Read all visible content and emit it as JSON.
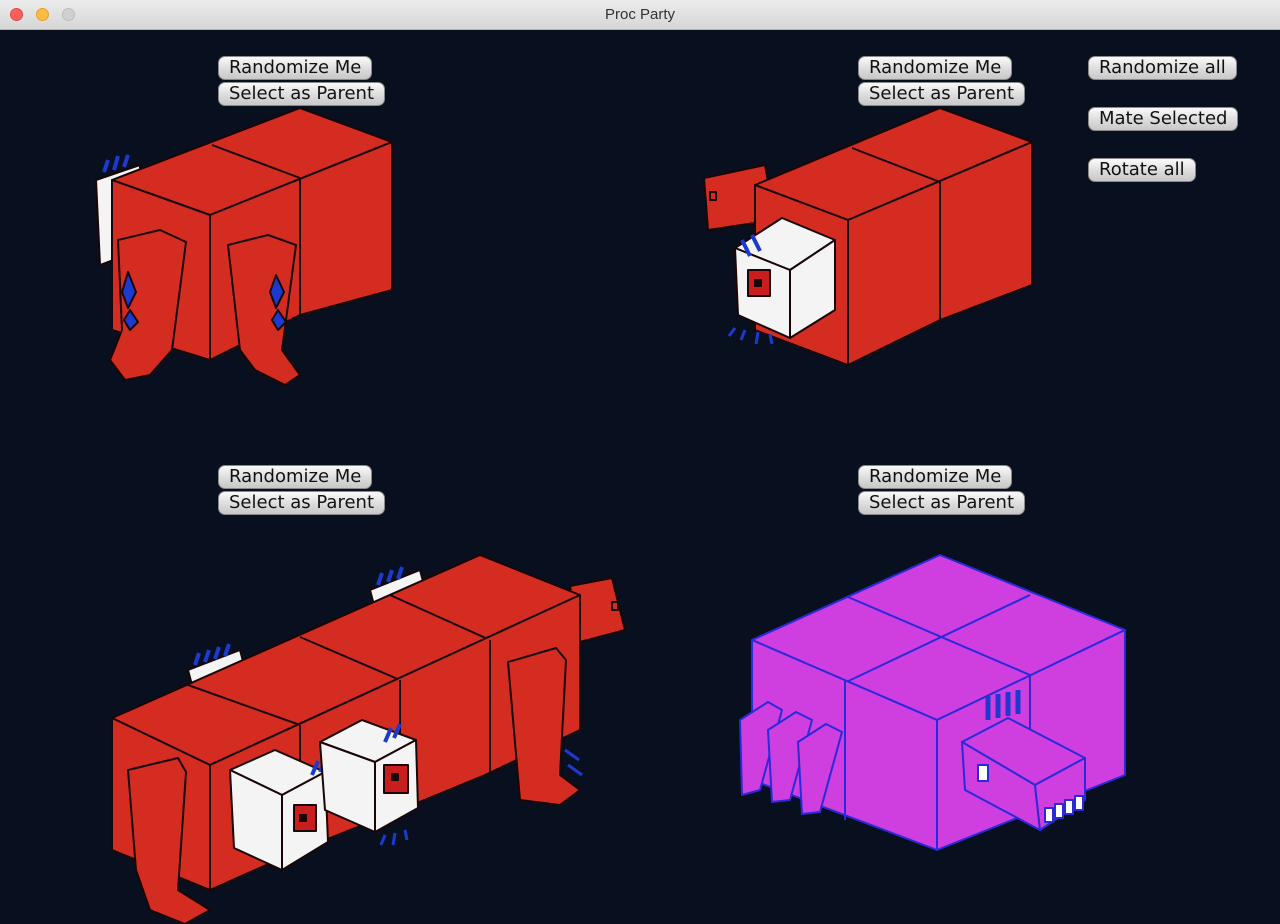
{
  "window": {
    "title": "Proc Party"
  },
  "creatures": [
    {
      "randomize_label": "Randomize Me",
      "select_label": "Select as Parent",
      "body_color": "#d52c22",
      "outline": "#2a0a0a"
    },
    {
      "randomize_label": "Randomize Me",
      "select_label": "Select as Parent",
      "body_color": "#d52c22",
      "outline": "#2a0a0a"
    },
    {
      "randomize_label": "Randomize Me",
      "select_label": "Select as Parent",
      "body_color": "#d52c22",
      "outline": "#2a0a0a"
    },
    {
      "randomize_label": "Randomize Me",
      "select_label": "Select as Parent",
      "body_color": "#cf3fe0",
      "outline": "#2a2ad8"
    }
  ],
  "global_controls": {
    "randomize_all": "Randomize all",
    "mate_selected": "Mate Selected",
    "rotate_all": "Rotate all"
  },
  "colors": {
    "background": "#08101f",
    "limb_blue": "#1c3ad0",
    "eye_red": "#c81e1e",
    "eye_white": "#ffffff"
  }
}
